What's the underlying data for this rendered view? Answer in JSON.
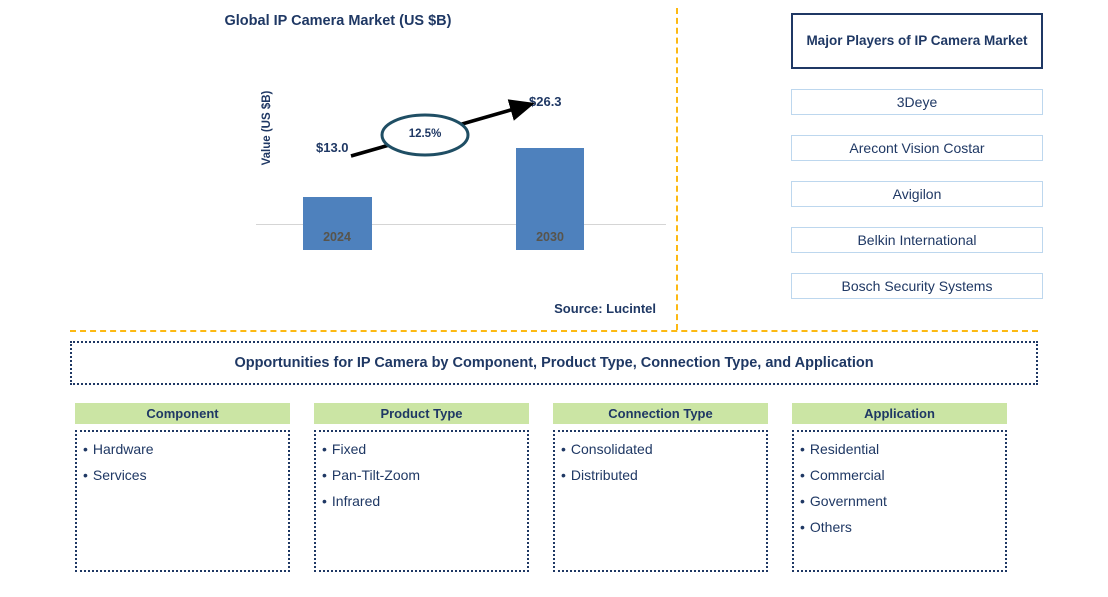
{
  "chart_panel": {
    "title": "Global IP Camera Market (US $B)",
    "y_axis_label": "Value (US $B)",
    "source": "Source: Lucintel"
  },
  "chart_data": {
    "type": "bar",
    "title": "Global IP Camera Market (US $B)",
    "xlabel": "",
    "ylabel": "Value (US $B)",
    "categories": [
      "2024",
      "2030"
    ],
    "values": [
      13.0,
      26.3
    ],
    "value_labels": [
      "$13.0",
      "$26.3"
    ],
    "ylim": [
      0,
      30
    ],
    "grid": false,
    "legend": "none",
    "bar_color": "#4e81bd",
    "annotations": [
      {
        "text": "12.5%",
        "kind": "cagr-callout-ellipse",
        "from_category": "2024",
        "to_category": "2030"
      }
    ]
  },
  "players_panel": {
    "header": "Major Players of IP Camera Market",
    "players": [
      "3Deye",
      "Arecont Vision Costar",
      "Avigilon",
      "Belkin International",
      "Bosch Security Systems"
    ]
  },
  "opportunities": {
    "banner": "Opportunities for IP Camera by Component, Product Type, Connection Type, and Application",
    "bullet_glyph": "•",
    "columns": [
      {
        "header": "Component",
        "items": [
          "Hardware",
          "Services"
        ]
      },
      {
        "header": "Product Type",
        "items": [
          "Fixed",
          "Pan-Tilt-Zoom",
          "Infrared"
        ]
      },
      {
        "header": "Connection Type",
        "items": [
          "Consolidated",
          "Distributed"
        ]
      },
      {
        "header": "Application",
        "items": [
          "Residential",
          "Commercial",
          "Government",
          "Others"
        ]
      }
    ]
  },
  "colors": {
    "accent_orange": "#fcb913",
    "navy": "#1f3864",
    "bar_blue": "#4e81bd",
    "header_green": "#cbe5a4",
    "player_border": "#bdd7ee"
  }
}
